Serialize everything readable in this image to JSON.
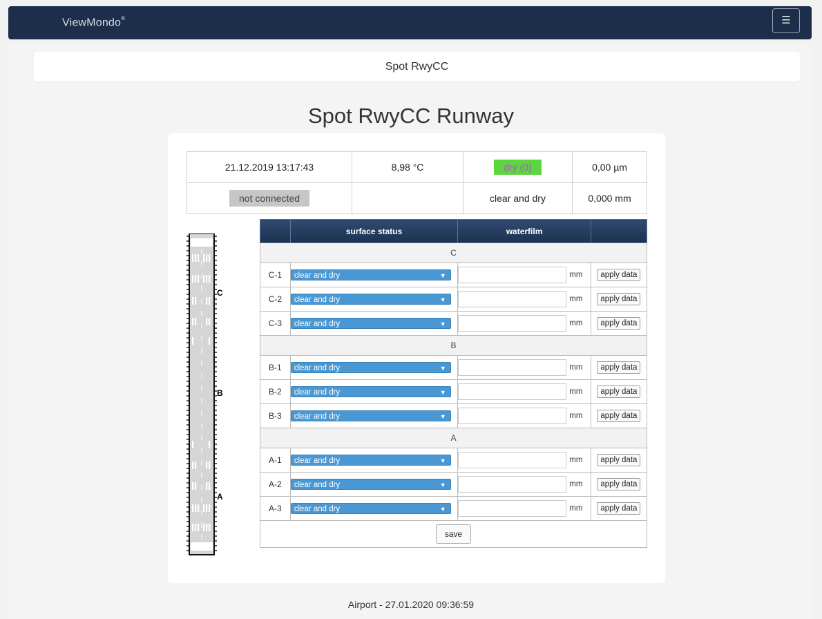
{
  "navbar": {
    "brand": "ViewMondo",
    "brand_sup": "®",
    "menu_icon": "☰"
  },
  "breadcrumb": "Spot RwyCC",
  "page_title": "Spot RwyCC Runway",
  "info": {
    "timestamp": "21.12.2019 13:17:43",
    "temperature": "8,98 °C",
    "status_badge": "dry (0)",
    "film_um": "0,00 µm",
    "connection": "not connected",
    "empty": "",
    "condition": "clear and dry",
    "film_mm": "0,000 mm"
  },
  "table": {
    "headers": [
      "",
      "surface status",
      "waterfilm",
      ""
    ],
    "unit": "mm",
    "apply_label": "apply data",
    "save_label": "save",
    "sections": [
      {
        "name": "C",
        "rows": [
          {
            "id": "C-1",
            "surface": "clear and dry",
            "water": ""
          },
          {
            "id": "C-2",
            "surface": "clear and dry",
            "water": ""
          },
          {
            "id": "C-3",
            "surface": "clear and dry",
            "water": ""
          }
        ]
      },
      {
        "name": "B",
        "rows": [
          {
            "id": "B-1",
            "surface": "clear and dry",
            "water": ""
          },
          {
            "id": "B-2",
            "surface": "clear and dry",
            "water": ""
          },
          {
            "id": "B-3",
            "surface": "clear and dry",
            "water": ""
          }
        ]
      },
      {
        "name": "A",
        "rows": [
          {
            "id": "A-1",
            "surface": "clear and dry",
            "water": ""
          },
          {
            "id": "A-2",
            "surface": "clear and dry",
            "water": ""
          },
          {
            "id": "A-3",
            "surface": "clear and dry",
            "water": ""
          }
        ]
      }
    ]
  },
  "runway": {
    "labels": [
      "C",
      "B",
      "A"
    ]
  },
  "footer": "Airport  -  27.01.2020 09:36:59"
}
